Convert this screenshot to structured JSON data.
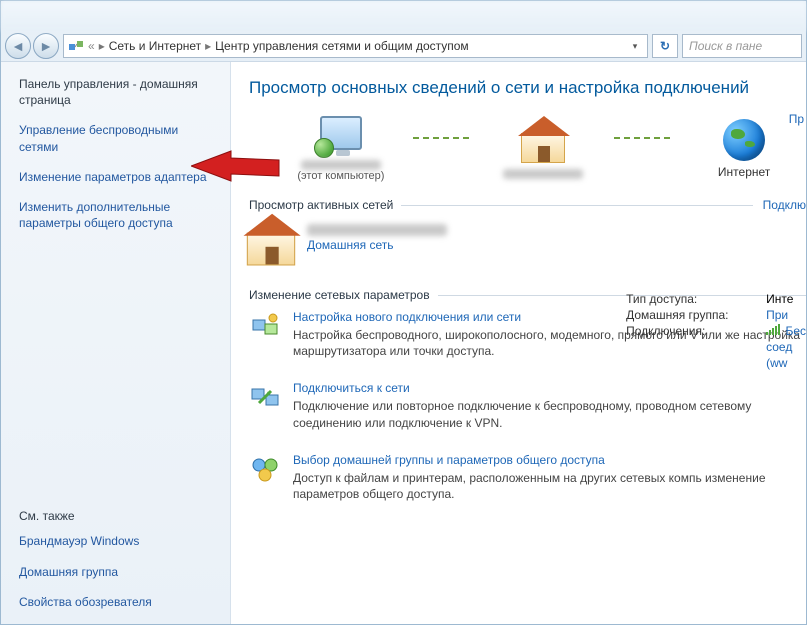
{
  "breadcrumb": {
    "segment1": "Сеть и Интернет",
    "segment2": "Центр управления сетями и общим доступом"
  },
  "search": {
    "placeholder": "Поиск в пане"
  },
  "sidebar": {
    "home": "Панель управления - домашняя страница",
    "links": [
      "Управление беспроводными сетями",
      "Изменение параметров адаптера",
      "Изменить дополнительные параметры общего доступа"
    ],
    "see_also_heading": "См. также",
    "see_also": [
      "Брандмауэр Windows",
      "Домашняя группа",
      "Свойства обозревателя"
    ]
  },
  "content": {
    "title": "Просмотр основных сведений о сети и настройка подключений",
    "map_right_link": "Пр",
    "nodes": {
      "this_pc_sub": "(этот компьютер)",
      "internet": "Интернет"
    },
    "active_heading": "Просмотр активных сетей",
    "active_right_link": "Подклю",
    "home_network_label": "Домашняя сеть",
    "props": {
      "access_label": "Тип доступа:",
      "access_value": "Инте",
      "homegroup_label": "Домашняя группа:",
      "homegroup_value": "При",
      "conn_label": "Подключения:",
      "conn_value": "Бес",
      "conn_value2": "соед",
      "conn_value3": "(ww"
    },
    "change_heading": "Изменение сетевых параметров",
    "settings": [
      {
        "title": "Настройка нового подключения или сети",
        "desc": "Настройка беспроводного, широкополосного, модемного, прямого или V или же настройка маршрутизатора или точки доступа."
      },
      {
        "title": "Подключиться к сети",
        "desc": "Подключение или повторное подключение к беспроводному, проводном сетевому соединению или подключение к VPN."
      },
      {
        "title": "Выбор домашней группы и параметров общего доступа",
        "desc": "Доступ к файлам и принтерам, расположенным на других сетевых компь изменение параметров общего доступа."
      }
    ]
  }
}
